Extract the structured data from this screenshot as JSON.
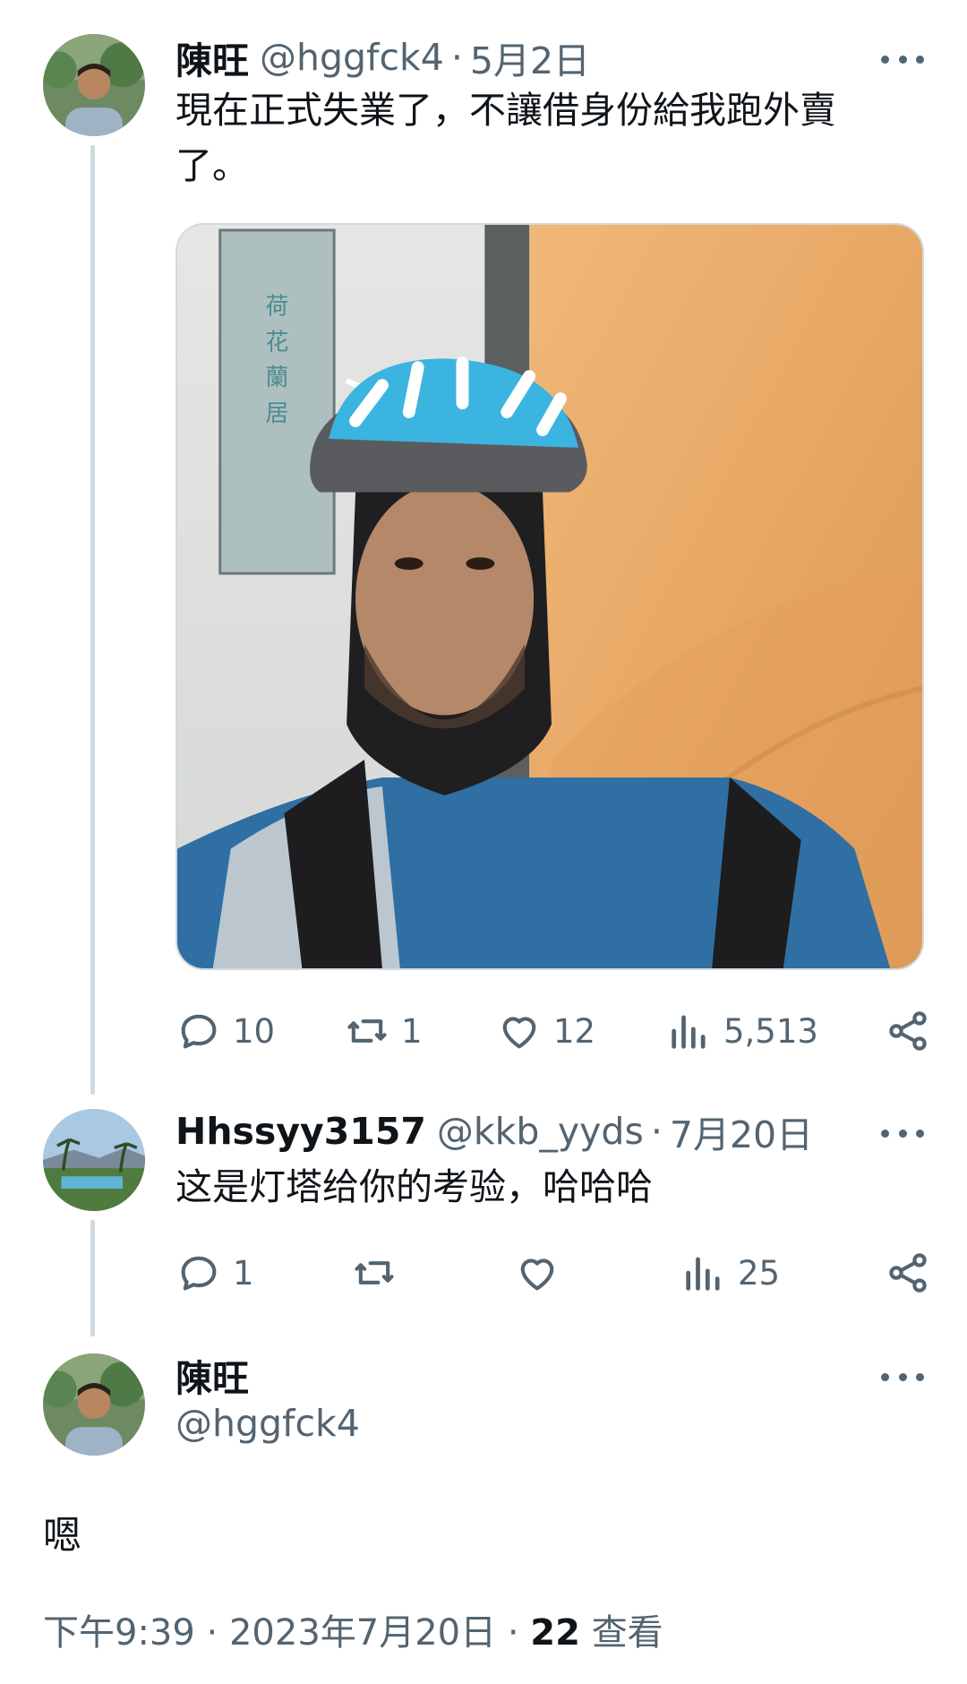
{
  "tweet1": {
    "display_name": "陳旺",
    "handle": "@hggfck4",
    "separator": "·",
    "date": "5月2日",
    "text": "現在正式失業了，不讓借身份給我跑外賣了。",
    "image_alt": "Selfie of man wearing a blue and white bicycle helmet",
    "stats": {
      "replies": "10",
      "retweets": "1",
      "likes": "12",
      "views": "5,513"
    }
  },
  "tweet2": {
    "display_name": "Hhssyy3157",
    "handle": "@kkb_yyds",
    "separator": "·",
    "date": "7月20日",
    "text": "这是灯塔给你的考验，哈哈哈",
    "stats": {
      "replies": "1",
      "retweets": "",
      "likes": "",
      "views": "25"
    }
  },
  "tweet3": {
    "display_name": "陳旺",
    "handle": "@hggfck4",
    "text": "嗯",
    "time": "下午9:39",
    "separator": "·",
    "date": "2023年7月20日",
    "view_count": "22",
    "view_label": "查看"
  },
  "colors": {
    "text_primary": "#0f1419",
    "text_secondary": "#536471",
    "thread_line": "#cfd9de"
  },
  "icons": [
    "reply-icon",
    "retweet-icon",
    "like-icon",
    "views-icon",
    "share-icon",
    "more-icon"
  ]
}
